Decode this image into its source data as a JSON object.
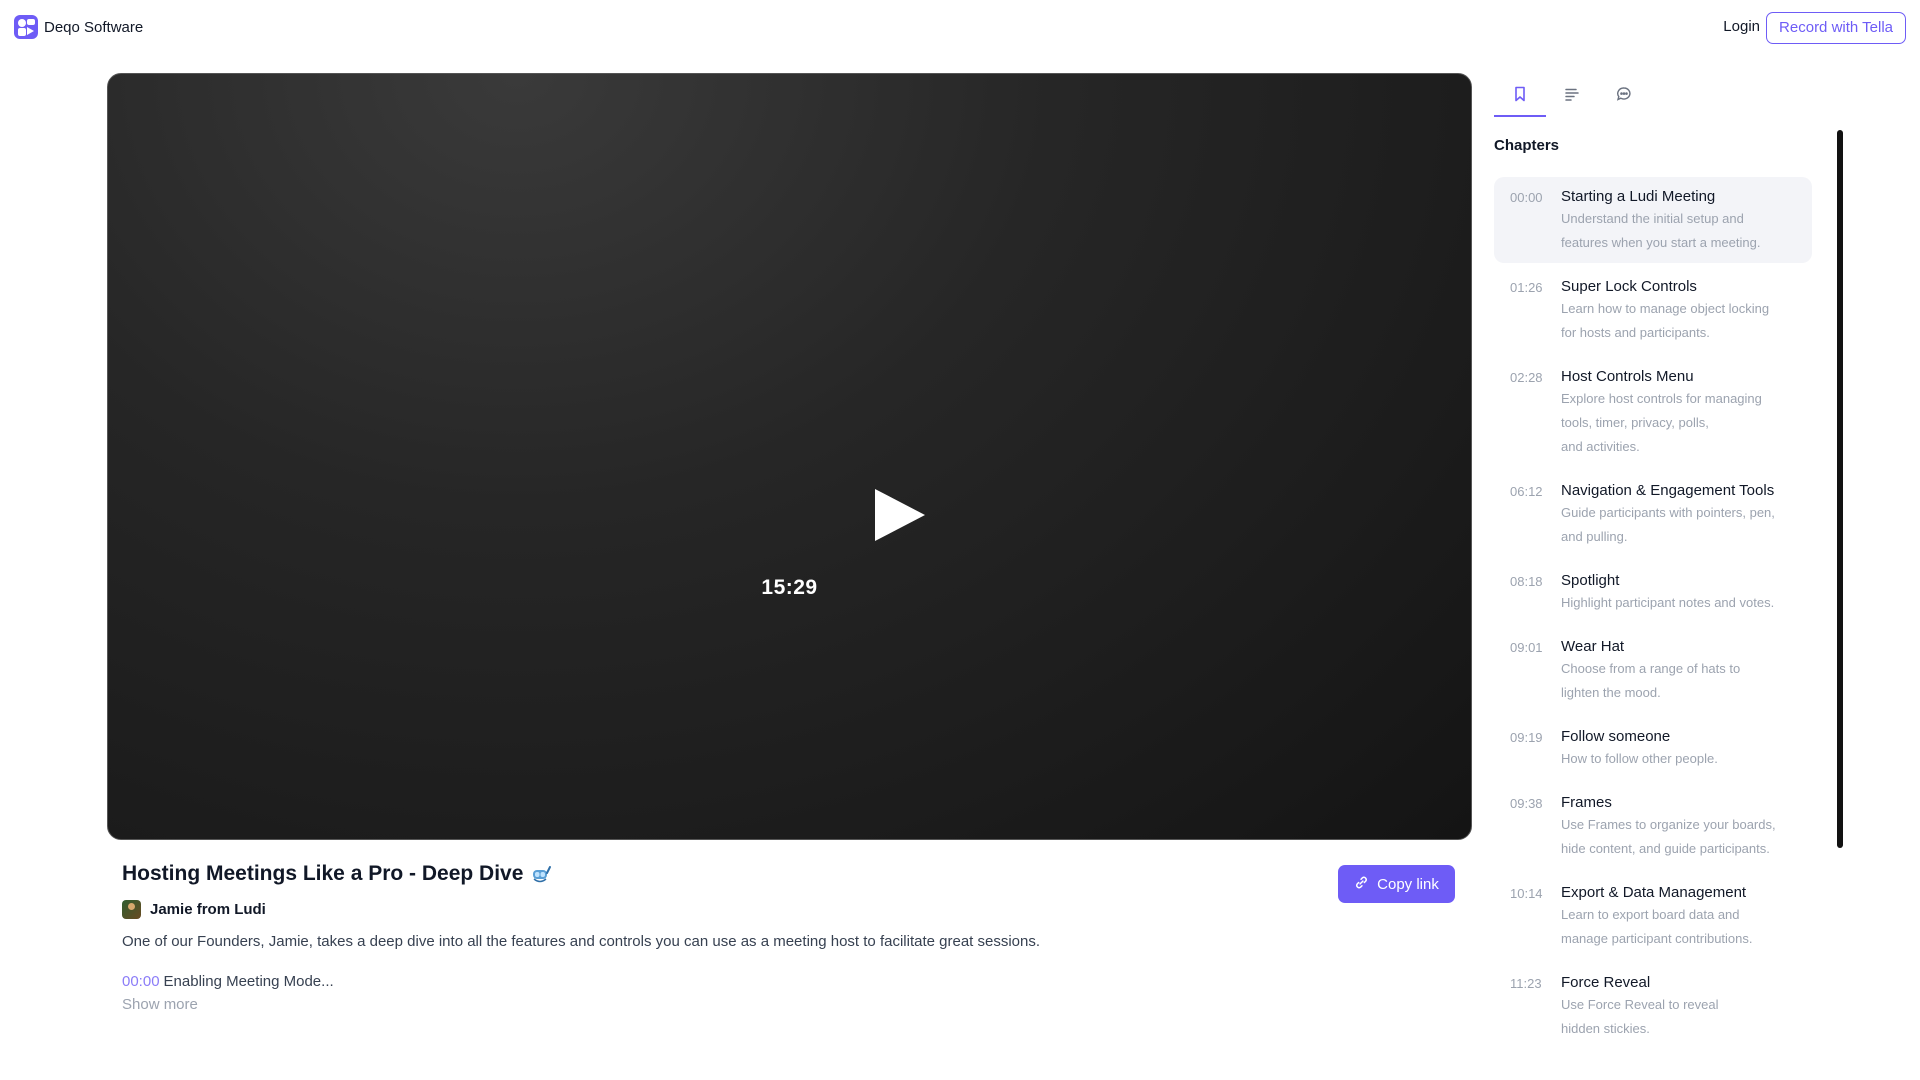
{
  "header": {
    "brand_name": "Deqo Software",
    "login_label": "Login",
    "record_label": "Record with Tella"
  },
  "video": {
    "duration": "15:29"
  },
  "info": {
    "title": "Hosting Meetings Like a Pro - Deep Dive",
    "title_emoji_icon": "diving-mask-icon",
    "copy_label": "Copy link",
    "author": "Jamie from Ludi",
    "description": "One of our Founders, Jamie, takes a deep dive into all the features and controls you can use as a meeting host to facilitate great sessions.",
    "first_chapter_time": "00:00",
    "first_chapter_text": "Enabling Meeting Mode...",
    "show_more": "Show more"
  },
  "sidebar": {
    "tabs": [
      "bookmark-icon",
      "transcript-icon",
      "comment-icon"
    ],
    "heading": "Chapters",
    "chapters": [
      {
        "time": "00:00",
        "title": "Starting a Ludi Meeting",
        "desc": "Understand the initial setup and\nfeatures when you start a meeting."
      },
      {
        "time": "01:26",
        "title": "Super Lock Controls",
        "desc": "Learn how to manage object locking\nfor hosts and participants."
      },
      {
        "time": "02:28",
        "title": "Host Controls Menu",
        "desc": "Explore host controls for managing\ntools, timer, privacy, polls,\nand activities."
      },
      {
        "time": "06:12",
        "title": "Navigation & Engagement Tools",
        "desc": "Guide participants with pointers, pen,\nand pulling."
      },
      {
        "time": "08:18",
        "title": "Spotlight",
        "desc": "Highlight participant notes and votes."
      },
      {
        "time": "09:01",
        "title": "Wear Hat",
        "desc": "Choose from a range of hats to\nlighten the mood."
      },
      {
        "time": "09:19",
        "title": "Follow someone",
        "desc": "How to follow other people."
      },
      {
        "time": "09:38",
        "title": "Frames",
        "desc": "Use Frames to organize your boards,\nhide content, and guide participants."
      },
      {
        "time": "10:14",
        "title": "Export & Data Management",
        "desc": "Learn to export board data and\nmanage participant contributions."
      },
      {
        "time": "11:23",
        "title": "Force Reveal",
        "desc": "Use Force Reveal to reveal\nhidden stickies."
      }
    ]
  },
  "colors": {
    "accent": "#6e5cf6",
    "muted": "#9ca3af",
    "timestamp_link": "#8b7cf8"
  }
}
